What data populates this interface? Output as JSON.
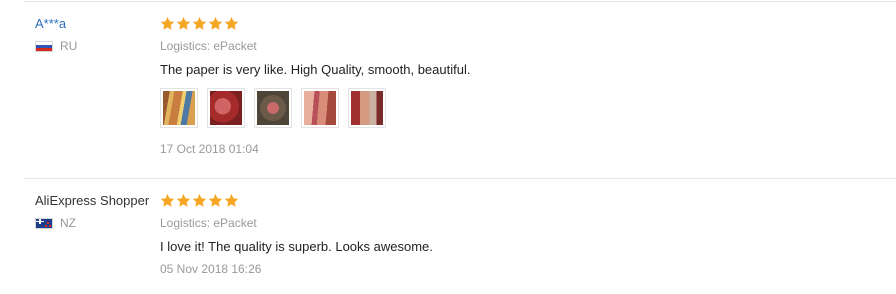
{
  "colors": {
    "star": "#f5a623",
    "username_link": "#2e6ebe",
    "muted": "#999999"
  },
  "reviews": [
    {
      "user": "A***a",
      "country": "RU",
      "flag": "russia-flag",
      "rating": 5,
      "logistics": "Logistics: ePacket",
      "text": "The paper is very like. High Quality, smooth, beautiful.",
      "photos": [
        "photo-1",
        "photo-2",
        "photo-3",
        "photo-4",
        "photo-5"
      ],
      "date": "17 Oct 2018 01:04"
    },
    {
      "user": "AliExpress Shopper",
      "country": "NZ",
      "flag": "new-zealand-flag",
      "rating": 5,
      "logistics": "Logistics: ePacket",
      "text": "I love it! The quality is superb. Looks awesome.",
      "photos": [],
      "date": "05 Nov 2018 16:26"
    }
  ]
}
